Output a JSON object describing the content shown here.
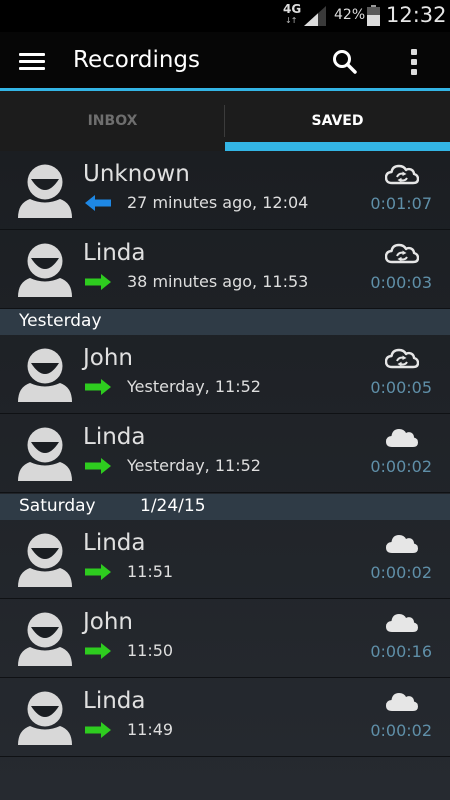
{
  "status_bar": {
    "network": "4G",
    "battery_percent": "42%",
    "time": "12:32"
  },
  "action_bar": {
    "title": "Recordings",
    "icons": [
      "menu-icon",
      "search-icon",
      "overflow-icon"
    ]
  },
  "tabs": [
    {
      "label": "INBOX",
      "selected": false
    },
    {
      "label": "SAVED",
      "selected": true
    }
  ],
  "colors": {
    "accent": "#33b5e5",
    "incoming_arrow": "#1e88e5",
    "outgoing_arrow": "#2ecc1f",
    "duration": "#5f8fa8",
    "section_header": "#2f3b46"
  },
  "recordings": [
    {
      "name": "Unknown",
      "direction": "incoming",
      "time": "27 minutes ago, 12:04",
      "duration": "0:01:07",
      "cloud": "cloud-sync-icon"
    },
    {
      "name": "Linda",
      "direction": "outgoing",
      "time": "38 minutes ago, 11:53",
      "duration": "0:00:03",
      "cloud": "cloud-sync-icon"
    },
    {
      "name": "John",
      "direction": "outgoing",
      "time": "Yesterday, 11:52",
      "duration": "0:00:05",
      "cloud": "cloud-sync-icon"
    },
    {
      "name": "Linda",
      "direction": "outgoing",
      "time": "Yesterday, 11:52",
      "duration": "0:00:02",
      "cloud": "cloud-icon"
    },
    {
      "name": "Linda",
      "direction": "outgoing",
      "time": "11:51",
      "duration": "0:00:02",
      "cloud": "cloud-icon"
    },
    {
      "name": "John",
      "direction": "outgoing",
      "time": "11:50",
      "duration": "0:00:16",
      "cloud": "cloud-icon"
    },
    {
      "name": "Linda",
      "direction": "outgoing",
      "time": "11:49",
      "duration": "0:00:02",
      "cloud": "cloud-icon"
    }
  ],
  "sections": [
    {
      "label": "Yesterday",
      "date": ""
    },
    {
      "label": "Saturday",
      "date": "1/24/15"
    }
  ]
}
